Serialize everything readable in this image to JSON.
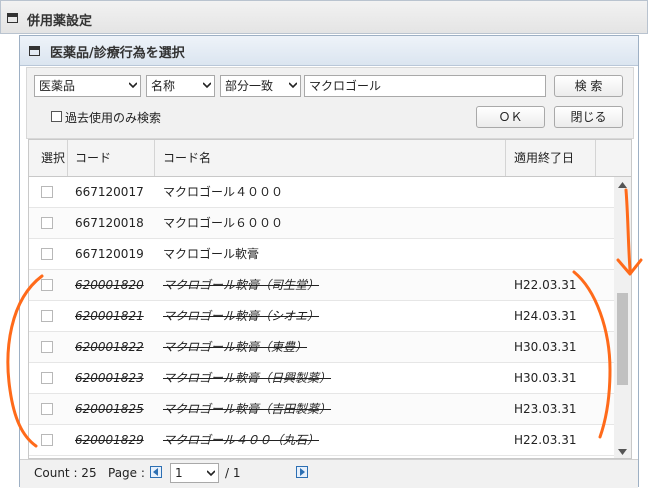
{
  "window": {
    "title": "併用薬設定"
  },
  "panel": {
    "title": "医薬品/診療行為を選択"
  },
  "filters": {
    "category": "医薬品",
    "field": "名称",
    "match": "部分一致",
    "keyword": "マクロゴール",
    "past_only_label": "過去使用のみ検索"
  },
  "buttons": {
    "search": "検 索",
    "ok": "ＯＫ",
    "close": "閉じる"
  },
  "table": {
    "headers": {
      "select": "選択",
      "code": "コード",
      "name": "コード名",
      "end_date": "適用終了日"
    },
    "rows": [
      {
        "code": "667120017",
        "name": "マクロゴール４０００",
        "end_date": "",
        "expired": false
      },
      {
        "code": "667120018",
        "name": "マクロゴール６０００",
        "end_date": "",
        "expired": false
      },
      {
        "code": "667120019",
        "name": "マクロゴール軟膏",
        "end_date": "",
        "expired": false
      },
      {
        "code": "620001820",
        "name": "マクロゴール軟膏（司生堂）",
        "end_date": "H22.03.31",
        "expired": true
      },
      {
        "code": "620001821",
        "name": "マクロゴール軟膏（シオエ）",
        "end_date": "H24.03.31",
        "expired": true
      },
      {
        "code": "620001822",
        "name": "マクロゴール軟膏（東豊）",
        "end_date": "H30.03.31",
        "expired": true
      },
      {
        "code": "620001823",
        "name": "マクロゴール軟膏（日興製薬）",
        "end_date": "H30.03.31",
        "expired": true
      },
      {
        "code": "620001825",
        "name": "マクロゴール軟膏（吉田製薬）",
        "end_date": "H23.03.31",
        "expired": true
      },
      {
        "code": "620001829",
        "name": "マクロゴール４００（丸石）",
        "end_date": "H22.03.31",
        "expired": true
      }
    ]
  },
  "footer": {
    "count_label": "Count : 25",
    "page_label": "Page :",
    "page_value": "1",
    "page_total": "/  1"
  },
  "colors": {
    "annotation": "#ff6a1a",
    "pager": "#2c6fb3"
  }
}
